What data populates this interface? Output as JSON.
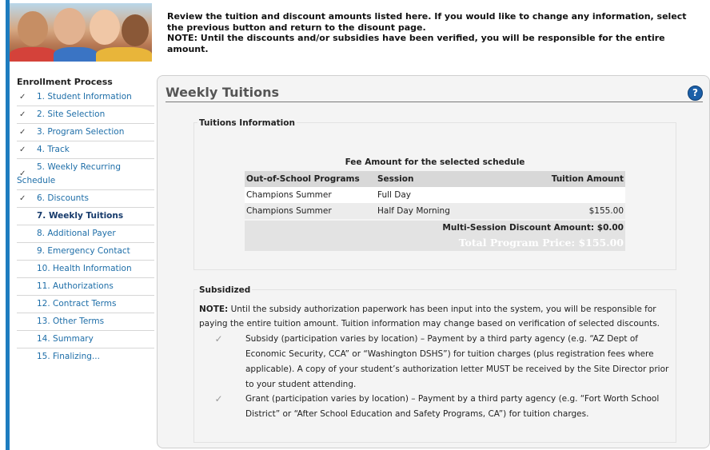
{
  "intro": {
    "line1": "Review the tuition and discount amounts listed here. If you would like to change any information, select the previous button and return to the disount page.",
    "note": "NOTE: Until the discounts and/or subsidies have been verified, you will be responsible for the entire amount."
  },
  "sidebar": {
    "heading": "Enrollment Process",
    "items": [
      {
        "label": "1. Student Information",
        "done": true
      },
      {
        "label": "2. Site Selection",
        "done": true
      },
      {
        "label": "3. Program Selection",
        "done": true
      },
      {
        "label": "4. Track",
        "done": true
      },
      {
        "label_a": "5. Weekly Recurring",
        "label_b": "Schedule",
        "done": true
      },
      {
        "label": "6. Discounts",
        "done": true
      },
      {
        "label": "7. Weekly Tuitions",
        "active": true
      },
      {
        "label": "8. Additional Payer"
      },
      {
        "label": "9. Emergency Contact"
      },
      {
        "label": "10. Health Information"
      },
      {
        "label": "11. Authorizations"
      },
      {
        "label": "12. Contract Terms"
      },
      {
        "label": "13. Other Terms"
      },
      {
        "label": "14. Summary"
      },
      {
        "label": "15. Finalizing..."
      }
    ],
    "check_glyph": "✓"
  },
  "panel": {
    "title": "Weekly Tuitions",
    "help_glyph": "?"
  },
  "tuitions": {
    "legend": "Tuitions Information",
    "caption": "Fee Amount for the selected schedule",
    "headers": {
      "program": "Out-of-School Programs",
      "session": "Session",
      "amount": "Tuition Amount"
    },
    "rows": [
      {
        "program": "Champions Summer",
        "session": "Full Day",
        "amount": ""
      },
      {
        "program": "Champions Summer",
        "session": "Half Day Morning",
        "amount": "$155.00"
      }
    ],
    "discount_label": "Multi-Session Discount Amount: $0.00",
    "total_label": "Total Program Price: $155.00"
  },
  "subsidized": {
    "legend": "Subsidized",
    "note_bold": "NOTE:",
    "note_text": " Until the subsidy authorization paperwork has been input into the system, you will be responsible for paying the entire tuition amount. Tuition information may change based on verification of selected discounts.",
    "options": [
      {
        "text": "Subsidy (participation varies by location) – Payment by a third party agency (e.g. “AZ Dept of Economic Security, CCA” or “Washington DSHS”) for tuition charges (plus registration fees where applicable). A copy of your student’s authorization letter MUST be received by the Site Director prior to your student attending.",
        "checked": true
      },
      {
        "text": "Grant (participation varies by location) – Payment by a third party agency (e.g. “Fort Worth School District” or “After School Education and Safety Programs, CA”) for tuition charges.",
        "checked": true
      }
    ]
  },
  "colors": {
    "accent": "#1d7cbf",
    "nav_link": "#1e6ea8",
    "active_nav": "#163a6b",
    "help": "#1b5fa8"
  }
}
